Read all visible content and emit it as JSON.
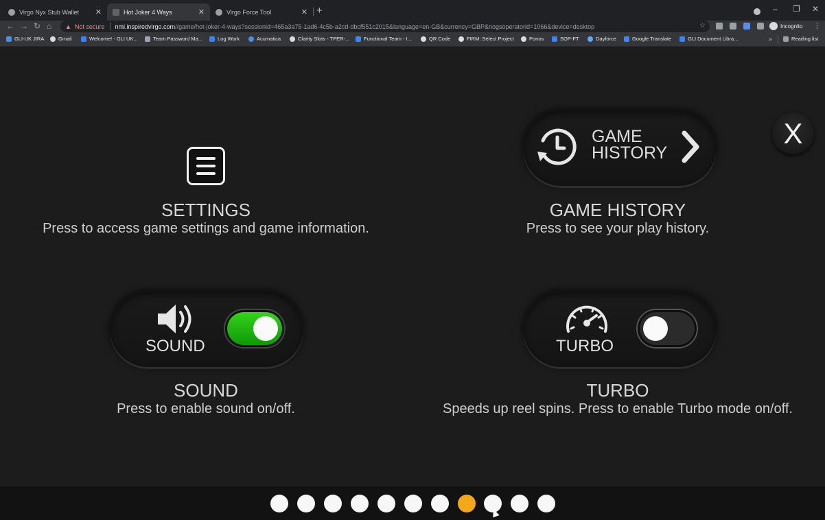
{
  "browser": {
    "tabs": [
      {
        "title": "Virgo Nyx Stub Wallet",
        "active": false
      },
      {
        "title": "Hot Joker 4 Ways",
        "active": true
      },
      {
        "title": "Virgo Force Tool",
        "active": false
      }
    ],
    "new_tab_label": "+",
    "security_label": "Not secure",
    "url_host": "nmi.inspiredvirgo.com",
    "url_path": "//game/hot-joker-4-ways?sessionid=465a3a75-1ad6-4c5b-a2cd-dbcf551c2015&language=en-GB&currency=GBP&nogsoperatorid=1066&device=desktop",
    "profile_label": "Incognito",
    "bookmarks": [
      {
        "label": "GLI-UK JIRA",
        "color": "#4a90e2"
      },
      {
        "label": "Gmail",
        "color": "#dadce0"
      },
      {
        "label": "Welcome! - GLI UK...",
        "color": "#3b82f6"
      },
      {
        "label": "Team Password Ma...",
        "color": "#9ca3af"
      },
      {
        "label": "Log Work",
        "color": "#3b82f6"
      },
      {
        "label": "Acumatica",
        "color": "#4a90e2"
      },
      {
        "label": "Clarity Slots - TPER-...",
        "color": "#dadce0"
      },
      {
        "label": "Functional Team - I...",
        "color": "#4285f4"
      },
      {
        "label": "QR Code",
        "color": "#dadce0"
      },
      {
        "label": "FIRM: Select Project",
        "color": "#dadce0"
      },
      {
        "label": "Ponos",
        "color": "#dadce0"
      },
      {
        "label": "SOP-FT",
        "color": "#3b82f6"
      },
      {
        "label": "Dayforce",
        "color": "#60a5fa"
      },
      {
        "label": "Google Translate",
        "color": "#4285f4"
      },
      {
        "label": "GLI Document Libra...",
        "color": "#3b82f6"
      }
    ],
    "bookmarks_more": "»",
    "reading_list_label": "Reading list"
  },
  "menu": {
    "close_label": "X",
    "settings": {
      "heading": "SETTINGS",
      "description": "Press to access game settings and game information."
    },
    "game_history": {
      "button_line1": "GAME",
      "button_line2": "HISTORY",
      "heading": "GAME HISTORY",
      "description": "Press to see your play history."
    },
    "sound": {
      "button_label": "SOUND",
      "toggle_on": true,
      "heading": "SOUND",
      "description": "Press to enable sound on/off."
    },
    "turbo": {
      "button_label": "TURBO",
      "toggle_on": false,
      "heading": "TURBO",
      "description": "Speeds up reel spins. Press to enable Turbo mode on/off."
    }
  },
  "pagination": {
    "total_pages": 11,
    "active_page": 8
  },
  "colors": {
    "accent_active_dot": "#f5a71a",
    "toggle_on_green": "#22c20f",
    "background": "#1c1c1c"
  }
}
